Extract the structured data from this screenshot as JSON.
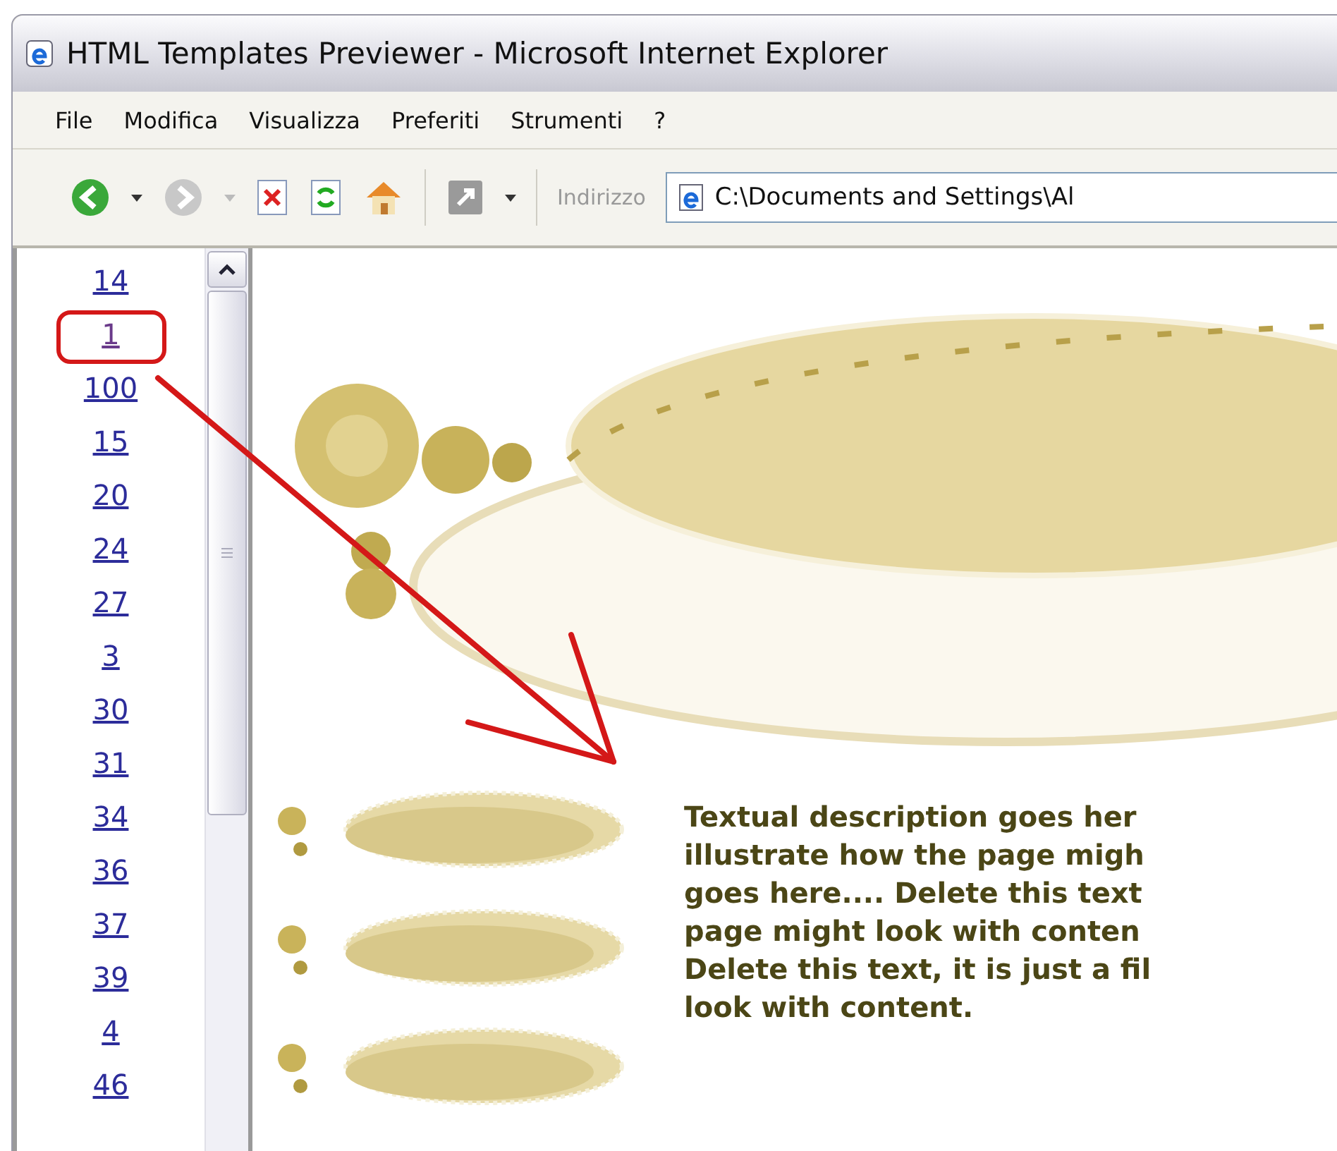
{
  "window": {
    "title": "HTML Templates Previewer - Microsoft Internet Explorer"
  },
  "menu": [
    "File",
    "Modifica",
    "Visualizza",
    "Preferiti",
    "Strumenti",
    "?"
  ],
  "toolbar": {
    "address_label": "Indirizzo",
    "address": "C:\\Documents and Settings\\Al"
  },
  "template_list": [
    {
      "label": "14",
      "circled": false
    },
    {
      "label": "1",
      "circled": true
    },
    {
      "label": "100",
      "circled": false
    },
    {
      "label": "15",
      "circled": false
    },
    {
      "label": "20",
      "circled": false
    },
    {
      "label": "24",
      "circled": false
    },
    {
      "label": "27",
      "circled": false
    },
    {
      "label": "3",
      "circled": false
    },
    {
      "label": "30",
      "circled": false
    },
    {
      "label": "31",
      "circled": false
    },
    {
      "label": "34",
      "circled": false
    },
    {
      "label": "36",
      "circled": false
    },
    {
      "label": "37",
      "circled": false
    },
    {
      "label": "39",
      "circled": false
    },
    {
      "label": "4",
      "circled": false
    },
    {
      "label": "46",
      "circled": false
    }
  ],
  "preview": {
    "description_lines": [
      "Textual description goes her",
      "illustrate how the page migh",
      "goes here.... Delete this text",
      "page might look with conten",
      "Delete this text, it is just a fil",
      "look with content."
    ]
  }
}
